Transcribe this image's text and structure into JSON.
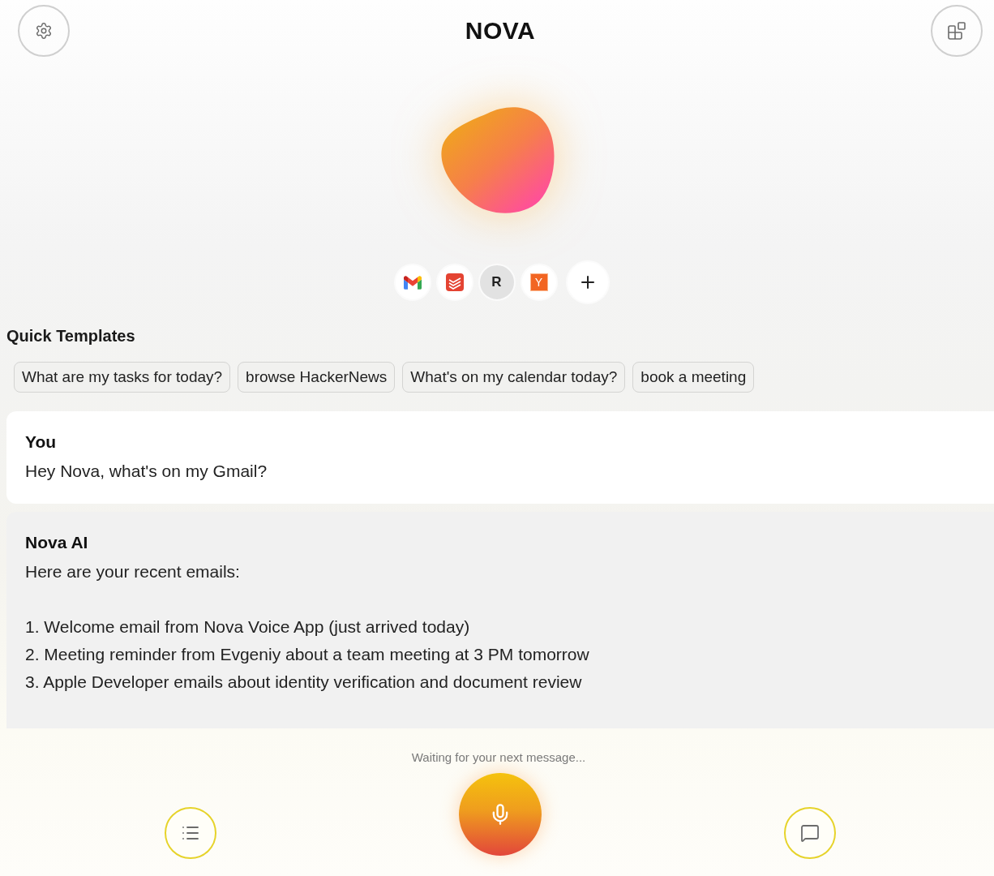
{
  "header": {
    "title": "NOVA"
  },
  "integrations": [
    {
      "kind": "mail"
    },
    {
      "kind": "tasks"
    },
    {
      "kind": "initial",
      "label": "R"
    },
    {
      "kind": "tile",
      "label": "Y"
    },
    {
      "kind": "add"
    }
  ],
  "templates": {
    "title": "Quick Templates",
    "items": [
      "What are my tasks for today?",
      "browse HackerNews",
      "What's on my calendar today?",
      "book a meeting"
    ]
  },
  "messages": [
    {
      "kind": "user",
      "author": "You",
      "paragraphs": [
        [
          "Hey Nova, what's on my Gmail?"
        ]
      ]
    },
    {
      "kind": "assistant",
      "author": "Nova AI",
      "paragraphs": [
        [
          "Here are your recent emails:"
        ],
        [
          "1. Welcome email from Nova Voice App (just arrived today)",
          "2. Meeting reminder from Evgeniy about a team meeting at 3 PM tomorrow",
          "3. Apple Developer emails about identity verification and document review"
        ]
      ]
    }
  ],
  "status": "Waiting for your next message..."
}
